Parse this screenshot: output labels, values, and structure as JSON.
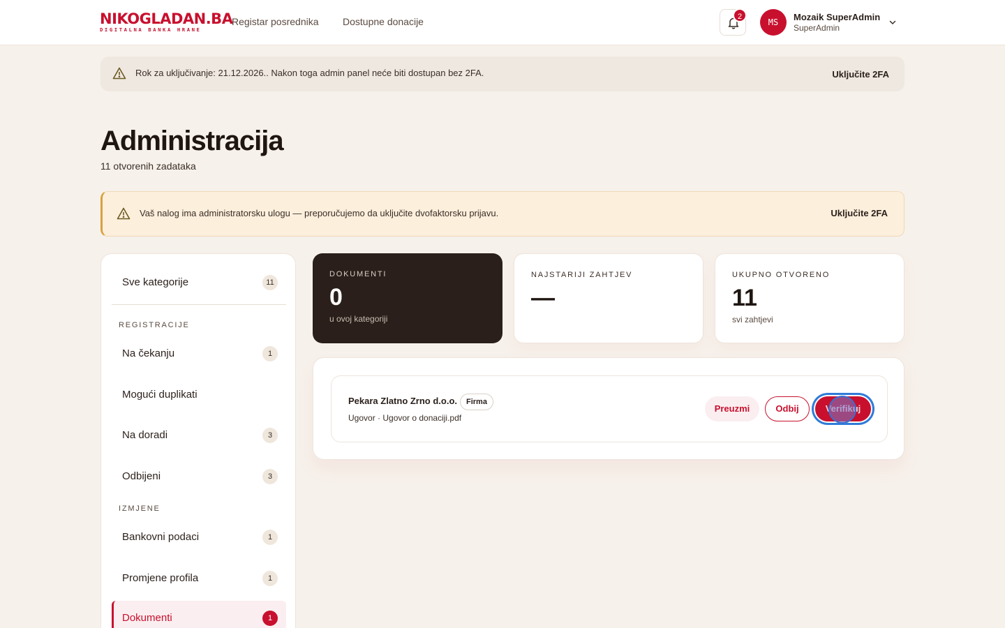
{
  "header": {
    "logo_main_a": "NIKO",
    "logo_main_b": "GLADAN.BA",
    "logo_sub": "DIGITALNA BANKA HRANE",
    "nav": [
      "Registar posrednika",
      "Dostupne donacije"
    ],
    "notification_count": "2",
    "user": {
      "initials": "MS",
      "name": "Mozaik SuperAdmin",
      "role": "SuperAdmin"
    }
  },
  "banner_deadline": {
    "text": "Rok za uključivanje: 21.12.2026.. Nakon toga admin panel neće biti dostupan bez 2FA.",
    "action": "Uključite 2FA"
  },
  "page": {
    "title": "Administracija",
    "subtitle": "11 otvorenih zadataka"
  },
  "banner_admin": {
    "text": "Vaš nalog ima administratorsku ulogu — preporučujemo da uključite dvofaktorsku prijavu.",
    "action": "Uključite 2FA"
  },
  "sidebar": {
    "all": {
      "label": "Sve kategorije",
      "count": "11"
    },
    "section_registracije": "REGISTRACIJE",
    "section_izmjene": "IZMJENE",
    "items": [
      {
        "label": "Na čekanju",
        "count": "1"
      },
      {
        "label": "Mogući duplikati",
        "count": ""
      },
      {
        "label": "Na doradi",
        "count": "3"
      },
      {
        "label": "Odbijeni",
        "count": "3"
      },
      {
        "label": "Bankovni podaci",
        "count": "1"
      },
      {
        "label": "Promjene profila",
        "count": "1"
      },
      {
        "label": "Dokumenti",
        "count": "1"
      }
    ]
  },
  "stats": [
    {
      "label": "DOKUMENTI",
      "value": "0",
      "caption": "u ovoj kategoriji"
    },
    {
      "label": "NAJSTARIJI ZAHTJEV",
      "value": "—",
      "caption": ""
    },
    {
      "label": "UKUPNO OTVORENO",
      "value": "11",
      "caption": "svi zahtjevi"
    }
  ],
  "documents": [
    {
      "name": "Pekara Zlatno Zrno d.o.o.",
      "tag": "Firma",
      "meta": "Ugovor · Ugovor o donaciji.pdf",
      "actions": {
        "download": "Preuzmi",
        "reject": "Odbij",
        "verify": "Verifikuj"
      }
    }
  ],
  "icons": {
    "warning": "warning-triangle-icon",
    "bell": "bell-icon",
    "chevron": "chevron-down-icon"
  },
  "colors": {
    "brand": "#c8102e",
    "dark_card": "#2a1f1a",
    "background": "#f7f1eb",
    "focus_ring": "#2f7bd8"
  }
}
